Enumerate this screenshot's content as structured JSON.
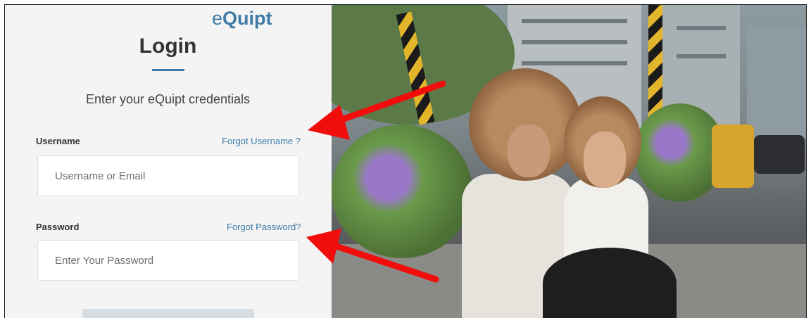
{
  "brand": {
    "logo_prefix": "e",
    "logo_suffix": "Quipt",
    "accent_color": "#3e7ca7"
  },
  "login": {
    "title": "Login",
    "subtitle": "Enter your eQuipt credentials",
    "username": {
      "label": "Username",
      "forgot_label": "Forgot Username ?",
      "placeholder": "Username or Email",
      "value": ""
    },
    "password": {
      "label": "Password",
      "forgot_label": "Forgot Password?",
      "placeholder": "Enter Your Password",
      "value": ""
    },
    "submit_label": ""
  },
  "annotations": {
    "arrow_color": "#f20d0d"
  }
}
